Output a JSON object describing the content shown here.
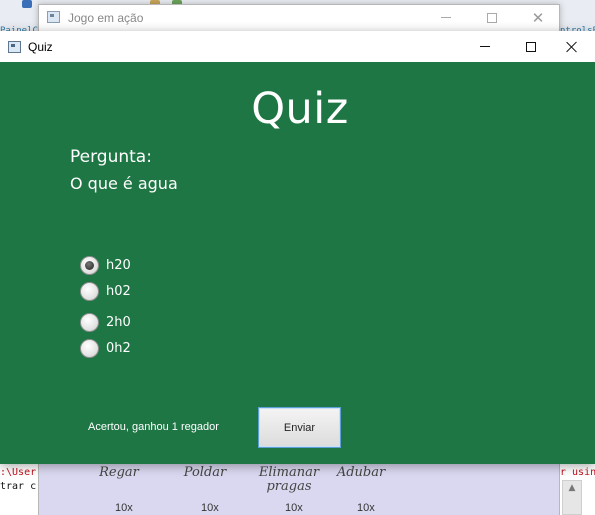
{
  "background_window": {
    "title": "Jogo em ação",
    "columns": [
      {
        "label": "Regar",
        "value": "10x"
      },
      {
        "label": "Poldar",
        "value": "10x"
      },
      {
        "label": "Elimanar pragas",
        "value": "10x"
      },
      {
        "label": "Adubar",
        "value": "10x"
      }
    ]
  },
  "ide": {
    "panel_left": "PainelCe",
    "panel_right": "ntrolsPa"
  },
  "console": {
    "left_lines": [
      ":\\User",
      "trar c"
    ],
    "right_lines": [
      "r usin",
      ""
    ]
  },
  "quiz_window": {
    "title": "Quiz",
    "heading": "Quiz",
    "question_label": "Pergunta:",
    "question_text": "O que é agua",
    "options": [
      {
        "label": "h20",
        "selected": true
      },
      {
        "label": "h02",
        "selected": false
      },
      {
        "label": "2h0",
        "selected": false
      },
      {
        "label": "0h2",
        "selected": false
      }
    ],
    "feedback": "Acertou, ganhou 1 regador",
    "submit_label": "Enviar"
  },
  "colors": {
    "quiz_background": "#1e7645",
    "background_panel": "#d9d8f0",
    "console_error": "#c0121b"
  }
}
